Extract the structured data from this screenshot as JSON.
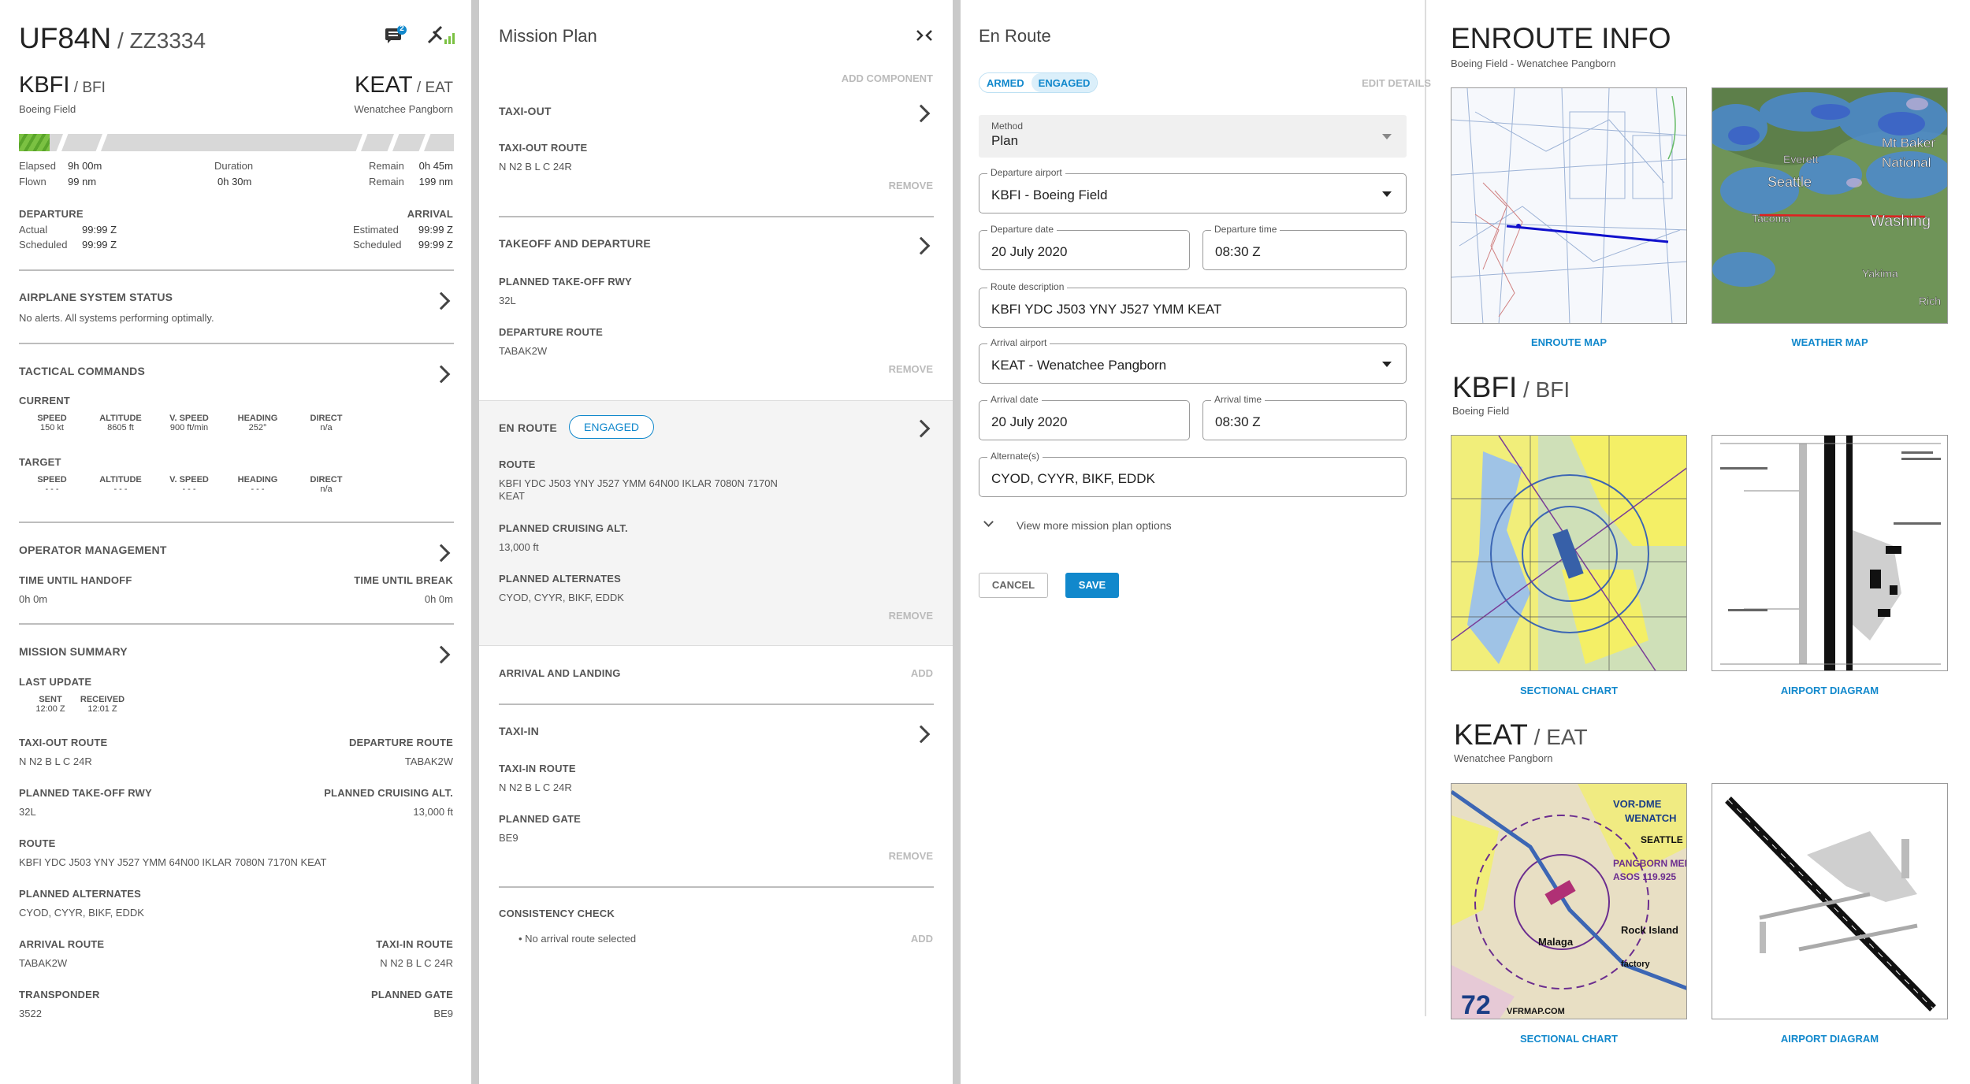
{
  "flight": {
    "tail": "UF84N",
    "callsign": "ZZ3334",
    "msg_count": "2"
  },
  "origin": {
    "icao": "KBFI",
    "iata": "BFI",
    "name": "Boeing Field"
  },
  "dest": {
    "icao": "KEAT",
    "iata": "EAT",
    "name": "Wenatchee Pangborn"
  },
  "progress": {
    "fraction": 0.07
  },
  "stats": {
    "elapsed_l": "Elapsed",
    "elapsed": "9h 00m",
    "flown_l": "Flown",
    "flown": "99 nm",
    "duration_l": "Duration",
    "duration": "0h 30m",
    "remain_l": "Remain",
    "remain_t": "0h 45m",
    "remain_n": "199 nm"
  },
  "times": {
    "departure": "DEPARTURE",
    "arrival": "ARRIVAL",
    "actual_l": "Actual",
    "actual": "99:99 Z",
    "sched_l": "Scheduled",
    "sched_dep": "99:99 Z",
    "est_l": "Estimated",
    "est": "99:99 Z",
    "sched_arr": "99:99 Z"
  },
  "system": {
    "title": "AIRPLANE SYSTEM STATUS",
    "status": "No alerts. All systems performing optimally."
  },
  "tactical": {
    "title": "TACTICAL COMMANDS",
    "current": "CURRENT",
    "target": "TARGET",
    "cols": [
      "SPEED",
      "ALTITUDE",
      "V. SPEED",
      "HEADING",
      "DIRECT"
    ],
    "current_vals": [
      "150 kt",
      "8605 ft",
      "900 ft/min",
      "252°",
      "n/a"
    ],
    "target_vals": [
      "- - -",
      "- - -",
      "- - -",
      "- - -",
      "n/a"
    ]
  },
  "operator": {
    "title": "OPERATOR MANAGEMENT",
    "handoff_l": "TIME UNTIL HANDOFF",
    "handoff": "0h 0m",
    "break_l": "TIME UNTIL BREAK",
    "break": "0h 0m"
  },
  "summary": {
    "title": "MISSION SUMMARY",
    "last_update": "LAST UPDATE",
    "sent_l": "SENT",
    "sent": "12:00 Z",
    "recv_l": "RECEIVED",
    "recv": "12:01 Z",
    "taxiout_l": "TAXI-OUT ROUTE",
    "taxiout": "N N2 B L C 24R",
    "deproute_l": "DEPARTURE ROUTE",
    "deproute": "TABAK2W",
    "rwy_l": "PLANNED TAKE-OFF RWY",
    "rwy": "32L",
    "alt_l": "PLANNED CRUISING ALT.",
    "alt": "13,000 ft",
    "route_l": "ROUTE",
    "route": "KBFI YDC J503 YNY J527 YMM 64N00 IKLAR 7080N 7170N KEAT",
    "alternates_l": "PLANNED ALTERNATES",
    "alternates": "CYOD, CYYR, BIKF, EDDK",
    "arrroute_l": "ARRIVAL ROUTE",
    "arrroute": "TABAK2W",
    "taxiin_l": "TAXI-IN ROUTE",
    "taxiin": "N N2 B L C 24R",
    "xpdr_l": "TRANSPONDER",
    "xpdr": "3522",
    "gate_l": "PLANNED GATE",
    "gate": "BE9"
  },
  "plan": {
    "title": "Mission Plan",
    "add_component": "ADD COMPONENT",
    "remove": "REMOVE",
    "add": "ADD",
    "taxiout": "TAXI-OUT",
    "taxiout_route_l": "TAXI-OUT ROUTE",
    "taxiout_route": "N N2 B L C 24R",
    "takeoff": "TAKEOFF AND DEPARTURE",
    "rwy_l": "PLANNED TAKE-OFF RWY",
    "rwy": "32L",
    "dep_route_l": "DEPARTURE ROUTE",
    "dep_route": "TABAK2W",
    "enroute": "EN ROUTE",
    "engaged": "ENGAGED",
    "route_l": "ROUTE",
    "route": "KBFI YDC J503 YNY J527 YMM 64N00 IKLAR 7080N 7170N KEAT",
    "cruise_l": "PLANNED CRUISING ALT.",
    "cruise": "13,000 ft",
    "alternates_l": "PLANNED ALTERNATES",
    "alternates": "CYOD, CYYR, BIKF, EDDK",
    "arrival": "ARRIVAL AND LANDING",
    "taxiin": "TAXI-IN",
    "taxiin_route_l": "TAXI-IN ROUTE",
    "taxiin_route": "N N2 B L C 24R",
    "gate_l": "PLANNED GATE",
    "gate": "BE9",
    "consistency": "CONSISTENCY CHECK",
    "consistency_item": "No arrival route selected"
  },
  "enroute": {
    "title": "En Route",
    "armed": "ARMED",
    "engaged": "ENGAGED",
    "edit": "EDIT DETAILS",
    "method_l": "Method",
    "method": "Plan",
    "dep_airport_l": "Departure airport",
    "dep_airport": "KBFI - Boeing Field",
    "dep_date_l": "Departure date",
    "dep_date": "20 July 2020",
    "dep_time_l": "Departure time",
    "dep_time": "08:30 Z",
    "route_l": "Route description",
    "route": "KBFI YDC J503 YNY J527 YMM KEAT",
    "arr_airport_l": "Arrival airport",
    "arr_airport": "KEAT - Wenatchee Pangborn",
    "arr_date_l": "Arrival date",
    "arr_date": "20 July 2020",
    "arr_time_l": "Arrival time",
    "arr_time": "08:30 Z",
    "alt_l": "Alternate(s)",
    "alt": "CYOD, CYYR, BIKF, EDDK",
    "more": "View more mission plan options",
    "cancel": "CANCEL",
    "save": "SAVE"
  },
  "info": {
    "title": "ENROUTE INFO",
    "subtitle": "Boeing Field - Wenatchee Pangborn",
    "enroute_map": "ENROUTE MAP",
    "weather_map": "WEATHER MAP",
    "kbfi_icao": "KBFI",
    "kbfi_iata": "BFI",
    "kbfi_name": "Boeing Field",
    "keat_icao": "KEAT",
    "keat_iata": "EAT",
    "keat_name": "Wenatchee Pangborn",
    "sectional": "SECTIONAL CHART",
    "airport_diagram": "AIRPORT DIAGRAM",
    "wx_labels": [
      "Everett",
      "Seattle",
      "Tacoma",
      "Yakima",
      "Mt Baker",
      "National",
      "Washing",
      "Rich"
    ],
    "sect2_labels": [
      "VOR-DME",
      "WENATCH",
      "PANGBORN MEM",
      "ASOS 119.925",
      "Rock Island",
      "Malaga",
      "factory",
      "VFRMAP.COM",
      "72",
      "SEATTLE"
    ]
  },
  "colors": {
    "accent": "#1188cc",
    "engaged_bg": "#dbeffa",
    "progress_green": "#7bc142"
  }
}
